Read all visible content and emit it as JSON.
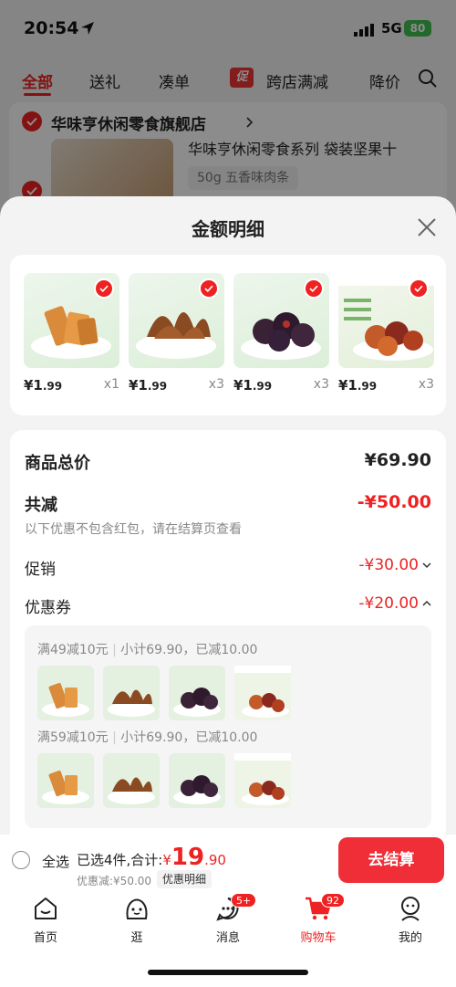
{
  "status_bar": {
    "time": "20:54",
    "network": "5G",
    "battery": "80"
  },
  "top_tabs": [
    {
      "label": "全部"
    },
    {
      "label": "送礼"
    },
    {
      "label": "凑单"
    },
    {
      "label": "跨店满减",
      "tag": "促"
    },
    {
      "label": "降价"
    }
  ],
  "store": {
    "name": "华味亨休闲零食旗舰店",
    "product_title": "华味亨休闲零食系列 袋装坚果十",
    "product_spec": "50g 五香味肉条"
  },
  "sheet": {
    "title": "金额明细",
    "products": [
      {
        "price_int": "¥1",
        "price_dec": ".99",
        "qty": "x1",
        "img": "sweet-potato"
      },
      {
        "price_int": "¥1",
        "price_dec": ".99",
        "qty": "x3",
        "img": "meat-strips"
      },
      {
        "price_int": "¥1",
        "price_dec": ".99",
        "qty": "x3",
        "img": "prunes"
      },
      {
        "price_int": "¥1",
        "price_dec": ".99",
        "qty": "x3",
        "img": "dates"
      }
    ],
    "total_label": "商品总价",
    "total_value": "¥69.90",
    "discount_label": "共减",
    "discount_value": "-¥50.00",
    "discount_note": "以下优惠不包含红包，请在结算页查看",
    "promo_label": "促销",
    "promo_value": "-¥30.00",
    "coupon_label": "优惠券",
    "coupon_value": "-¥20.00",
    "coupon_rules": [
      {
        "rule": "满49减10元",
        "detail": "小计69.90，已减10.00"
      },
      {
        "rule": "满59减10元",
        "detail": "小计69.90，已减10.00"
      }
    ]
  },
  "checkout": {
    "select_all": "全选",
    "selected_text": "已选4件,合计:",
    "currency": "¥",
    "amount_int": "19",
    "amount_dec": ".90",
    "discount_text": "优惠减:¥50.00",
    "detail_label": "优惠明细",
    "pay_button": "去结算"
  },
  "tab_bar": [
    {
      "label": "首页",
      "icon": "home-icon"
    },
    {
      "label": "逛",
      "icon": "browse-icon"
    },
    {
      "label": "消息",
      "icon": "message-icon",
      "badge": "5+"
    },
    {
      "label": "购物车",
      "icon": "cart-icon",
      "badge": "92",
      "active": true
    },
    {
      "label": "我的",
      "icon": "profile-icon"
    }
  ],
  "colors": {
    "accent": "#e22222",
    "pay_button": "#ef2e37"
  }
}
